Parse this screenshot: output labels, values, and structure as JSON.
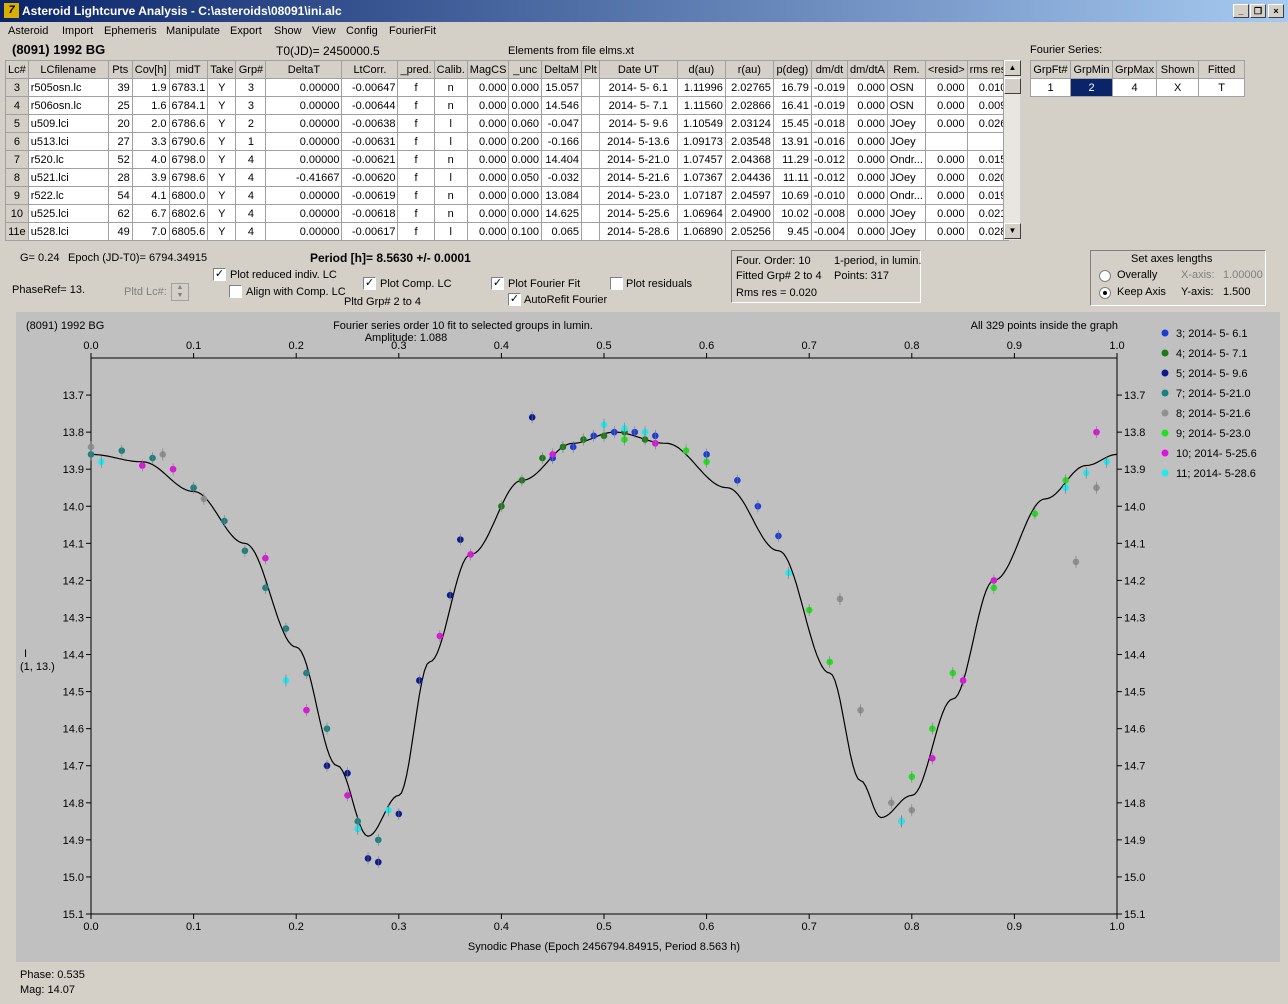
{
  "window": {
    "title": "Asteroid Lightcurve Analysis - C:\\asteroids\\08091\\ini.alc",
    "app_icon": "asteroid-app-icon",
    "minimize": "_",
    "restore": "❐",
    "close": "×"
  },
  "menu": [
    "Asteroid",
    "Import",
    "Ephemeris",
    "Manipulate",
    "Export",
    "Show",
    "View",
    "Config",
    "FourierFit"
  ],
  "header": {
    "object": "(8091) 1992 BG",
    "t0": "T0(JD)= 2450000.5",
    "elements": "Elements from file elms.xt",
    "fourier_series": "Fourier Series:"
  },
  "lc_table": {
    "columns": [
      "Lc#",
      "LCfilename",
      "Pts",
      "Cov[h]",
      "midT",
      "Take",
      "Grp#",
      "DeltaT",
      "LtCorr.",
      "_pred.",
      "Calib.",
      "MagCS",
      "_unc",
      "DeltaM",
      "Plt",
      "Date UT",
      "d(au)",
      "r(au)",
      "p(deg)",
      "dm/dt",
      "dm/dtA",
      "Rem.",
      "<resid>",
      "rms res"
    ],
    "rows": [
      [
        "3",
        "r505osn.lc",
        "39",
        "1.9",
        "6783.1",
        "Y",
        "3",
        "0.00000",
        "-0.00647",
        "f",
        "n",
        "0.000",
        "0.000",
        "15.057",
        "",
        "2014- 5- 6.1",
        "1.11996",
        "2.02765",
        "16.79",
        "-0.019",
        "0.000",
        "OSN",
        "0.000",
        "0.010"
      ],
      [
        "4",
        "r506osn.lc",
        "25",
        "1.6",
        "6784.1",
        "Y",
        "3",
        "0.00000",
        "-0.00644",
        "f",
        "n",
        "0.000",
        "0.000",
        "14.546",
        "",
        "2014- 5- 7.1",
        "1.11560",
        "2.02866",
        "16.41",
        "-0.019",
        "0.000",
        "OSN",
        "0.000",
        "0.009"
      ],
      [
        "5",
        "u509.lci",
        "20",
        "2.0",
        "6786.6",
        "Y",
        "2",
        "0.00000",
        "-0.00638",
        "f",
        "l",
        "0.000",
        "0.060",
        "-0.047",
        "",
        "2014- 5- 9.6",
        "1.10549",
        "2.03124",
        "15.45",
        "-0.018",
        "0.000",
        "JOey",
        "0.000",
        "0.026"
      ],
      [
        "6",
        "u513.lci",
        "27",
        "3.3",
        "6790.6",
        "Y",
        "1",
        "0.00000",
        "-0.00631",
        "f",
        "l",
        "0.000",
        "0.200",
        "-0.166",
        "",
        "2014- 5-13.6",
        "1.09173",
        "2.03548",
        "13.91",
        "-0.016",
        "0.000",
        "JOey",
        "",
        ""
      ],
      [
        "7",
        "r520.lc",
        "52",
        "4.0",
        "6798.0",
        "Y",
        "4",
        "0.00000",
        "-0.00621",
        "f",
        "n",
        "0.000",
        "0.000",
        "14.404",
        "",
        "2014- 5-21.0",
        "1.07457",
        "2.04368",
        "11.29",
        "-0.012",
        "0.000",
        "Ondr...",
        "0.000",
        "0.015"
      ],
      [
        "8",
        "u521.lci",
        "28",
        "3.9",
        "6798.6",
        "Y",
        "4",
        "-0.41667",
        "-0.00620",
        "f",
        "l",
        "0.000",
        "0.050",
        "-0.032",
        "",
        "2014- 5-21.6",
        "1.07367",
        "2.04436",
        "11.11",
        "-0.012",
        "0.000",
        "JOey",
        "0.000",
        "0.020"
      ],
      [
        "9",
        "r522.lc",
        "54",
        "4.1",
        "6800.0",
        "Y",
        "4",
        "0.00000",
        "-0.00619",
        "f",
        "n",
        "0.000",
        "0.000",
        "13.084",
        "",
        "2014- 5-23.0",
        "1.07187",
        "2.04597",
        "10.69",
        "-0.010",
        "0.000",
        "Ondr...",
        "0.000",
        "0.019"
      ],
      [
        "10",
        "u525.lci",
        "62",
        "6.7",
        "6802.6",
        "Y",
        "4",
        "0.00000",
        "-0.00618",
        "f",
        "n",
        "0.000",
        "0.000",
        "14.625",
        "",
        "2014- 5-25.6",
        "1.06964",
        "2.04900",
        "10.02",
        "-0.008",
        "0.000",
        "JOey",
        "0.000",
        "0.021"
      ],
      [
        "11e",
        "u528.lci",
        "49",
        "7.0",
        "6805.6",
        "Y",
        "4",
        "0.00000",
        "-0.00617",
        "f",
        "l",
        "0.000",
        "0.100",
        "0.065",
        "",
        "2014- 5-28.6",
        "1.06890",
        "2.05256",
        "9.45",
        "-0.004",
        "0.000",
        "JOey",
        "0.000",
        "0.028"
      ]
    ]
  },
  "fourier_table": {
    "columns": [
      "GrpFt#",
      "GrpMin",
      "GrpMax",
      "Shown",
      "Fitted"
    ],
    "row": [
      "1",
      "2",
      "4",
      "X",
      "T"
    ]
  },
  "controls": {
    "g": "G= 0.24",
    "epoch": "Epoch (JD-T0)= 6794.34915",
    "period": "Period [h]= 8.5630 +/- 0.0001",
    "phaseref": "PhaseRef= 13.",
    "pltd_lc": "Pltd Lc#:",
    "plot_reduced": "Plot reduced indiv. LC",
    "align_comp": "Align with Comp. LC",
    "plot_comp": "Plot Comp. LC",
    "pltd_grp": "Pltd Grp#  2  to  4",
    "plot_fourier": "Plot Fourier Fit",
    "autorefit": "AutoRefit Fourier",
    "plot_residuals": "Plot residuals",
    "four_order": "Four. Order: 10",
    "one_period": "1-period, in lumin.",
    "fitted_grp": "Fitted Grp# 2 to 4",
    "points": "Points: 317",
    "rms": "Rms res    = 0.020",
    "axes_title": "Set axes lengths",
    "overally": "Overally",
    "keep_axis": "Keep Axis",
    "xaxis_lbl": "X-axis:",
    "xaxis_val": "1.00000",
    "yaxis_lbl": "Y-axis:",
    "yaxis_val": "1.500"
  },
  "plot": {
    "object": "(8091) 1992 BG",
    "subtitle": "Fourier series order 10 fit to selected groups in lumin.",
    "amplitude": "Amplitude: 1.088",
    "points_note": "All 329 points inside the graph",
    "ylabel": "I",
    "ylabel2": "(1, 13.)",
    "xlabel": "Synodic Phase (Epoch 2456794.84915, Period 8.563 h)"
  },
  "chart_data": {
    "type": "scatter",
    "xlabel": "Synodic Phase (Epoch 2456794.84915, Period 8.563 h)",
    "ylabel": "I",
    "xlim": [
      0,
      1
    ],
    "ylim": [
      15.1,
      13.6
    ],
    "xticks": [
      "0.0",
      "0.1",
      "0.2",
      "0.3",
      "0.4",
      "0.5",
      "0.6",
      "0.7",
      "0.8",
      "0.9",
      "1.0"
    ],
    "yticks": [
      "13.7",
      "13.8",
      "13.9",
      "14.0",
      "14.1",
      "14.2",
      "14.3",
      "14.4",
      "14.5",
      "14.6",
      "14.7",
      "14.8",
      "14.9",
      "15.0",
      "15.1"
    ],
    "series": [
      {
        "name": "3; 2014- 5- 6.1",
        "color": "#1a3cd8",
        "x": [
          0.45,
          0.47,
          0.49,
          0.51,
          0.53,
          0.55,
          0.6,
          0.63,
          0.65,
          0.67
        ],
        "y": [
          13.87,
          13.84,
          13.81,
          13.8,
          13.8,
          13.81,
          13.86,
          13.93,
          14.0,
          14.08
        ]
      },
      {
        "name": "4; 2014- 5- 7.1",
        "color": "#1a7a1a",
        "x": [
          0.4,
          0.42,
          0.44,
          0.46,
          0.48,
          0.5,
          0.52,
          0.54
        ],
        "y": [
          14.0,
          13.93,
          13.87,
          13.84,
          13.82,
          13.81,
          13.8,
          13.82
        ]
      },
      {
        "name": "5; 2014- 5- 9.6",
        "color": "#0a1a8c",
        "x": [
          0.23,
          0.25,
          0.27,
          0.28,
          0.3,
          0.32,
          0.35,
          0.36,
          0.43
        ],
        "y": [
          14.7,
          14.72,
          14.95,
          14.96,
          14.83,
          14.47,
          14.24,
          14.09,
          13.76
        ]
      },
      {
        "name": "7; 2014- 5-21.0",
        "color": "#1a8080",
        "x": [
          0.0,
          0.03,
          0.06,
          0.1,
          0.13,
          0.15,
          0.17,
          0.19,
          0.21,
          0.23,
          0.26,
          0.28
        ],
        "y": [
          13.86,
          13.85,
          13.87,
          13.95,
          14.04,
          14.12,
          14.22,
          14.33,
          14.45,
          14.6,
          14.85,
          14.9
        ]
      },
      {
        "name": "8; 2014- 5-21.6",
        "color": "#909090",
        "x": [
          0.0,
          0.07,
          0.11,
          0.73,
          0.75,
          0.78,
          0.8,
          0.96,
          0.98
        ],
        "y": [
          13.84,
          13.86,
          13.98,
          14.25,
          14.55,
          14.8,
          14.82,
          14.15,
          13.95
        ]
      },
      {
        "name": "9; 2014- 5-23.0",
        "color": "#22e022",
        "x": [
          0.52,
          0.55,
          0.58,
          0.6,
          0.7,
          0.72,
          0.8,
          0.82,
          0.84,
          0.88,
          0.92,
          0.95
        ],
        "y": [
          13.82,
          13.83,
          13.85,
          13.88,
          14.28,
          14.42,
          14.73,
          14.6,
          14.45,
          14.22,
          14.02,
          13.93
        ]
      },
      {
        "name": "10; 2014- 5-25.6",
        "color": "#e010e0",
        "x": [
          0.05,
          0.08,
          0.17,
          0.21,
          0.25,
          0.26,
          0.34,
          0.37,
          0.45,
          0.55,
          0.79,
          0.82,
          0.85,
          0.88,
          0.98
        ],
        "y": [
          13.89,
          13.9,
          14.14,
          14.55,
          14.78,
          14.87,
          14.35,
          14.13,
          13.86,
          13.83,
          14.85,
          14.68,
          14.47,
          14.2,
          13.8
        ]
      },
      {
        "name": "11; 2014- 5-28.6",
        "color": "#22e8f0",
        "x": [
          0.01,
          0.19,
          0.26,
          0.29,
          0.5,
          0.52,
          0.54,
          0.68,
          0.79,
          0.95,
          0.97,
          0.99
        ],
        "y": [
          13.88,
          14.47,
          14.87,
          14.82,
          13.78,
          13.79,
          13.8,
          14.18,
          14.85,
          13.95,
          13.91,
          13.88
        ]
      }
    ]
  },
  "status": {
    "phase": "Phase:  0.535",
    "mag": "Mag:    14.07"
  }
}
